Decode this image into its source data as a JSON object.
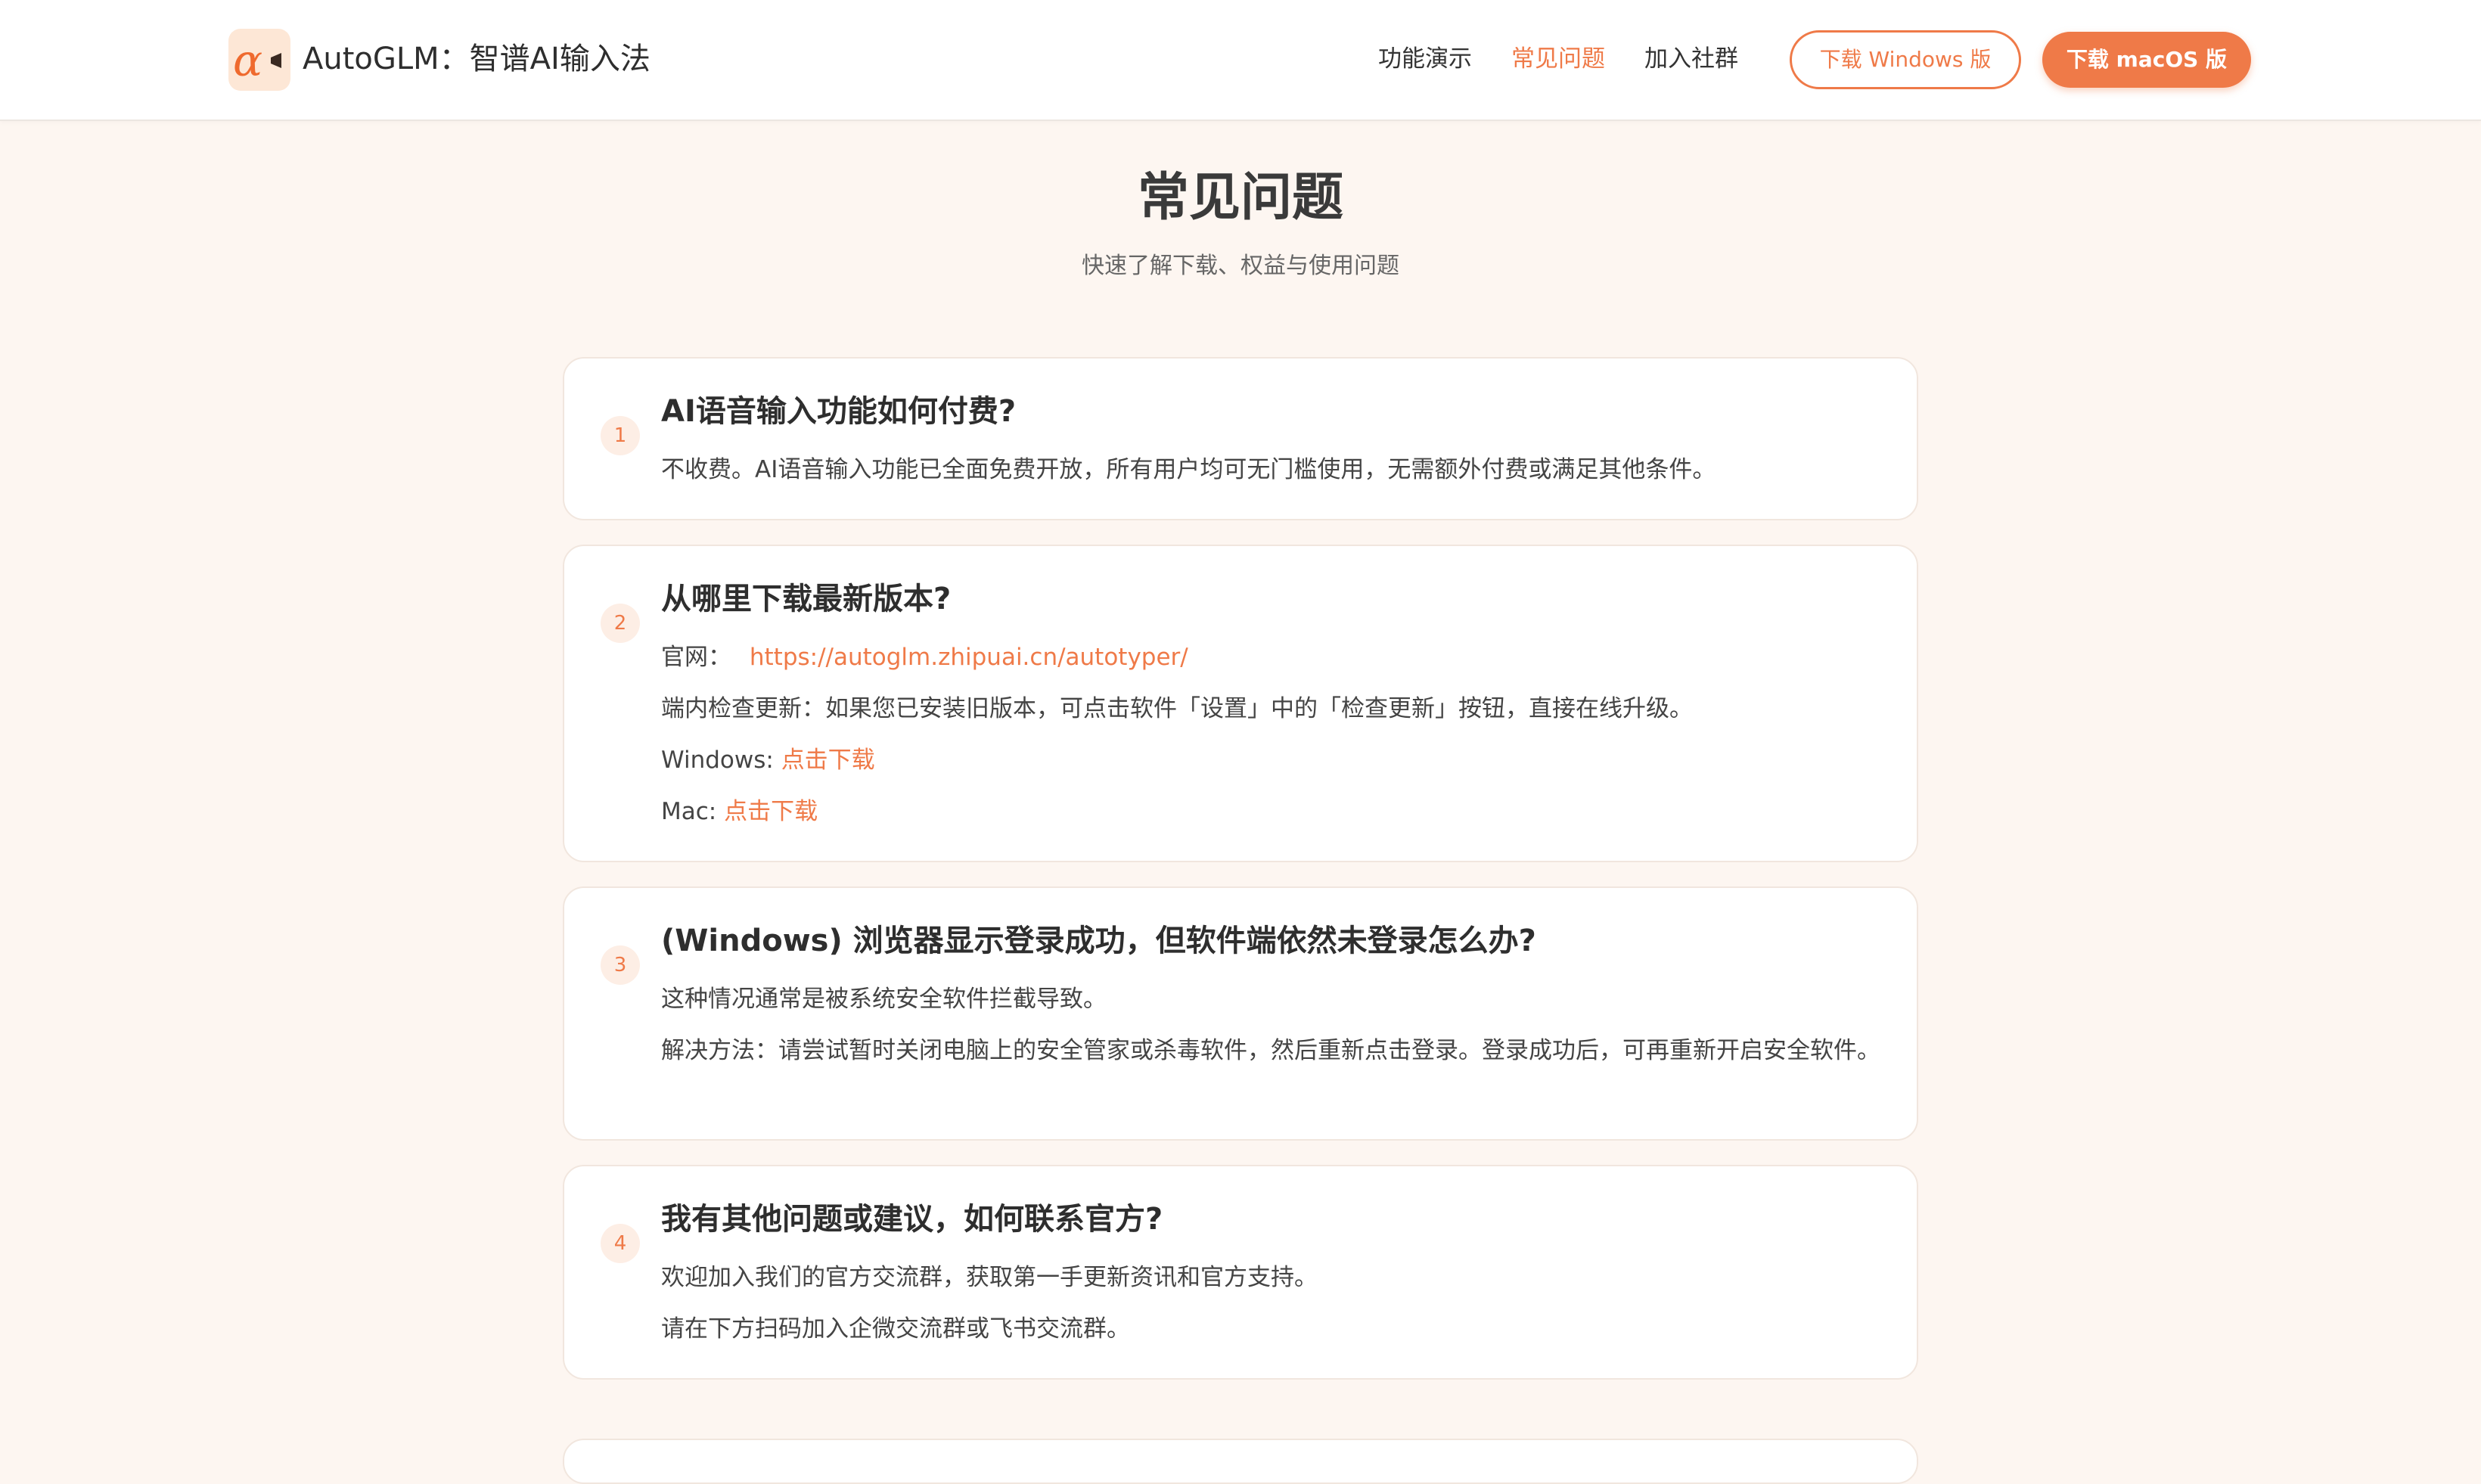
{
  "header": {
    "brand": "AutoGLM：智谱AI输入法",
    "nav": {
      "features": "功能演示",
      "faq": "常见问题",
      "community": "加入社群"
    },
    "download_windows": "下载 Windows 版",
    "download_macos": "下载 macOS 版",
    "logo_icon": "alpha-logo-icon",
    "accent_color": "#ef7a48"
  },
  "page": {
    "title": "常见问题",
    "subtitle": "快速了解下载、权益与使用问题"
  },
  "faq": [
    {
      "num": "1",
      "question": "AI语音输入功能如何付费?",
      "answer": "不收费。AI语音输入功能已全面免费开放，所有用户均可无门槛使用，无需额外付费或满足其他条件。"
    },
    {
      "num": "2",
      "question": "从哪里下载最新版本?",
      "site_label": "官网：",
      "site_url": "https://autoglm.zhipuai.cn/autotyper/",
      "update_text": "端内检查更新：如果您已安装旧版本，可点击软件「设置」中的「检查更新」按钮，直接在线升级。",
      "windows_label": "Windows:",
      "windows_link": "点击下载",
      "mac_label": "Mac:",
      "mac_link": "点击下载"
    },
    {
      "num": "3",
      "question": "(Windows) 浏览器显示登录成功，但软件端依然未登录怎么办?",
      "answer1": "这种情况通常是被系统安全软件拦截导致。",
      "answer2": "解决方法：请尝试暂时关闭电脑上的安全管家或杀毒软件，然后重新点击登录。登录成功后，可再重新开启安全软件。"
    },
    {
      "num": "4",
      "question": "我有其他问题或建议，如何联系官方?",
      "answer1": "欢迎加入我们的官方交流群，获取第一手更新资讯和官方支持。",
      "answer2": "请在下方扫码加入企微交流群或飞书交流群。"
    }
  ]
}
